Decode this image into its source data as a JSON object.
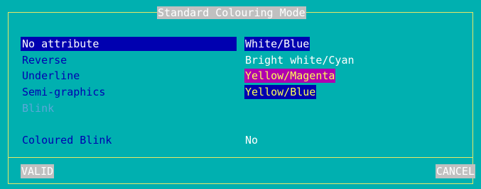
{
  "dialog": {
    "title": "Standard Colouring Mode"
  },
  "rows": [
    {
      "label": "No attribute",
      "value": "White/Blue"
    },
    {
      "label": "Reverse",
      "value": "Bright white/Cyan"
    },
    {
      "label": "Underline",
      "value": "Yellow/Magenta"
    },
    {
      "label": "Semi-graphics",
      "value": "Yellow/Blue"
    },
    {
      "label": "Blink",
      "value": ""
    }
  ],
  "coloured_blink": {
    "label": "Coloured Blink",
    "value": "No"
  },
  "buttons": {
    "valid": "VALID",
    "cancel": "CANCEL"
  },
  "colors": {
    "background": "#00b0b0",
    "border": "#e8e866",
    "label_text": "#0000b0",
    "selection": "#0000b0",
    "magenta": "#b000b0",
    "yellow": "#ffff55",
    "button_bg": "#c0c0c0",
    "disabled_text": "#5aa8d8"
  }
}
